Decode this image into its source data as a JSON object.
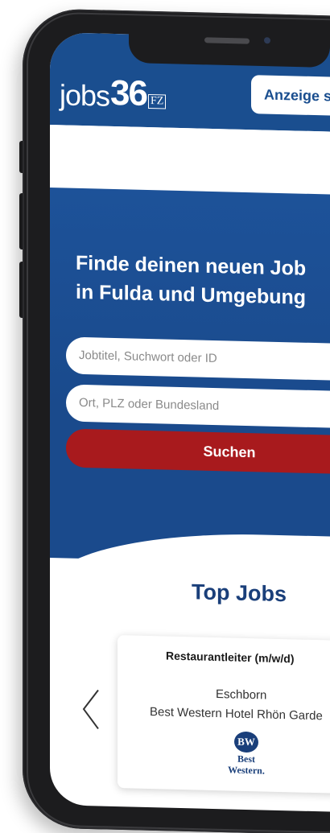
{
  "header": {
    "logo_text": "jobs",
    "logo_number": "36",
    "logo_suffix": "FZ",
    "cta_label": "Anzeige s"
  },
  "hero": {
    "title_line1": "Finde deinen neuen Job",
    "title_line2": "in Fulda und Umgebung",
    "job_field_placeholder": "Jobtitel, Suchwort oder ID",
    "location_field_placeholder": "Ort, PLZ oder Bundesland",
    "search_label": "Suchen"
  },
  "top_jobs": {
    "heading": "Top Jobs",
    "cards": [
      {
        "title": "Restaurantleiter (m/w/d)",
        "location": "Eschborn",
        "company": "Best Western Hotel Rhön Garde",
        "logo_badge": "BW",
        "logo_line1": "Best",
        "logo_line2": "Western."
      }
    ]
  },
  "colors": {
    "brand_blue": "#1a4e8f",
    "heading_blue": "#1a3f7a",
    "search_red": "#a81a1d",
    "phone_frame": "#1c1c1e"
  },
  "icons": {
    "prev": "chevron-left-icon"
  }
}
